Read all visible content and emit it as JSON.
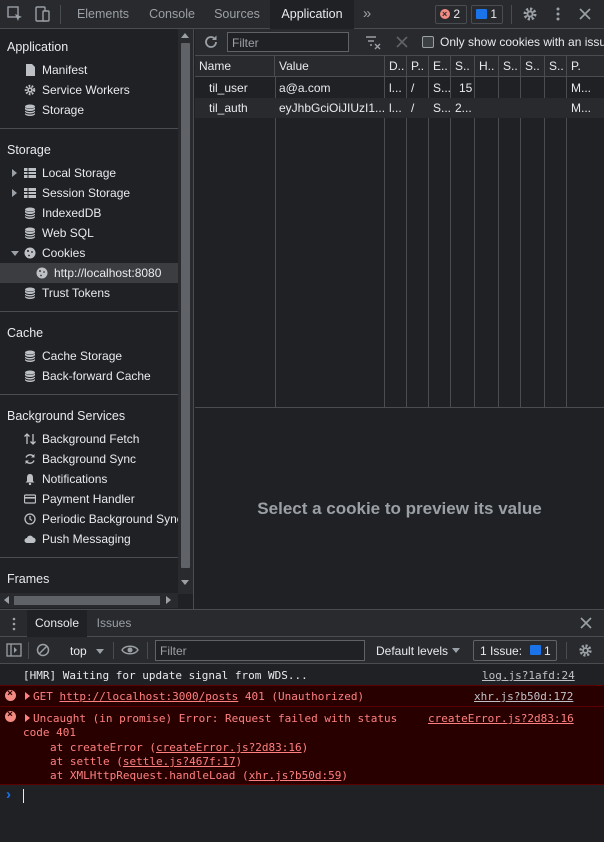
{
  "topbar": {
    "tabs": [
      "Elements",
      "Console",
      "Sources",
      "Application"
    ],
    "more_label": "»",
    "errors_count": "2",
    "messages_count": "1"
  },
  "sidebar": {
    "application": {
      "title": "Application",
      "items": [
        "Manifest",
        "Service Workers",
        "Storage"
      ]
    },
    "storage": {
      "title": "Storage",
      "items": [
        "Local Storage",
        "Session Storage",
        "IndexedDB",
        "Web SQL",
        "Cookies",
        "http://localhost:8080",
        "Trust Tokens"
      ]
    },
    "cache": {
      "title": "Cache",
      "items": [
        "Cache Storage",
        "Back-forward Cache"
      ]
    },
    "background": {
      "title": "Background Services",
      "items": [
        "Background Fetch",
        "Background Sync",
        "Notifications",
        "Payment Handler",
        "Periodic Background Sync",
        "Push Messaging"
      ]
    },
    "frames": {
      "title": "Frames"
    }
  },
  "cookies": {
    "filter_placeholder": "Filter",
    "only_issues_label": "Only show cookies with an issue",
    "columns": [
      "Name",
      "Value",
      "D..",
      "P..",
      "E..",
      "S..",
      "H..",
      "S..",
      "S..",
      "S..",
      "P."
    ],
    "rows": [
      [
        "til_user",
        "a@a.com",
        "l...",
        "/",
        "S...",
        "15",
        "",
        "",
        "",
        "",
        "M..."
      ],
      [
        "til_auth",
        "eyJhbGciOiJIUzI1...",
        "l...",
        "/",
        "S...",
        "2...",
        "",
        "",
        "",
        "",
        "M..."
      ]
    ],
    "preview_message": "Select a cookie to preview its value"
  },
  "console": {
    "tabs": [
      "Console",
      "Issues"
    ],
    "context": "top",
    "filter_placeholder": "Filter",
    "levels": "Default levels",
    "issues_label": "1 Issue:",
    "issues_count": "1",
    "messages": {
      "hmr": {
        "text": "[HMR] Waiting for update signal from WDS...",
        "source": "log.js?1afd:24"
      },
      "get": {
        "prefix": "GET ",
        "url": "http://localhost:3000/posts",
        "suffix": " 401 (Unauthorized)",
        "source": "xhr.js?b50d:172"
      },
      "uncaught": {
        "line1": "Uncaught (in promise) Error: Request failed with status",
        "line2": "code 401",
        "source": "createError.js?2d83:16",
        "stack": [
          {
            "pre": "at createError (",
            "link": "createError.js?2d83:16",
            "post": ")"
          },
          {
            "pre": "at settle (",
            "link": "settle.js?467f:17",
            "post": ")"
          },
          {
            "pre": "at XMLHttpRequest.handleLoad (",
            "link": "xhr.js?b50d:59",
            "post": ")"
          }
        ]
      }
    },
    "prompt": "›"
  },
  "colors": {
    "accent": "#1a73e8",
    "error_text": "#ff8080",
    "error_bg": "#290000",
    "panel_bg": "#202124",
    "toolbar_bg": "#292a2d"
  }
}
